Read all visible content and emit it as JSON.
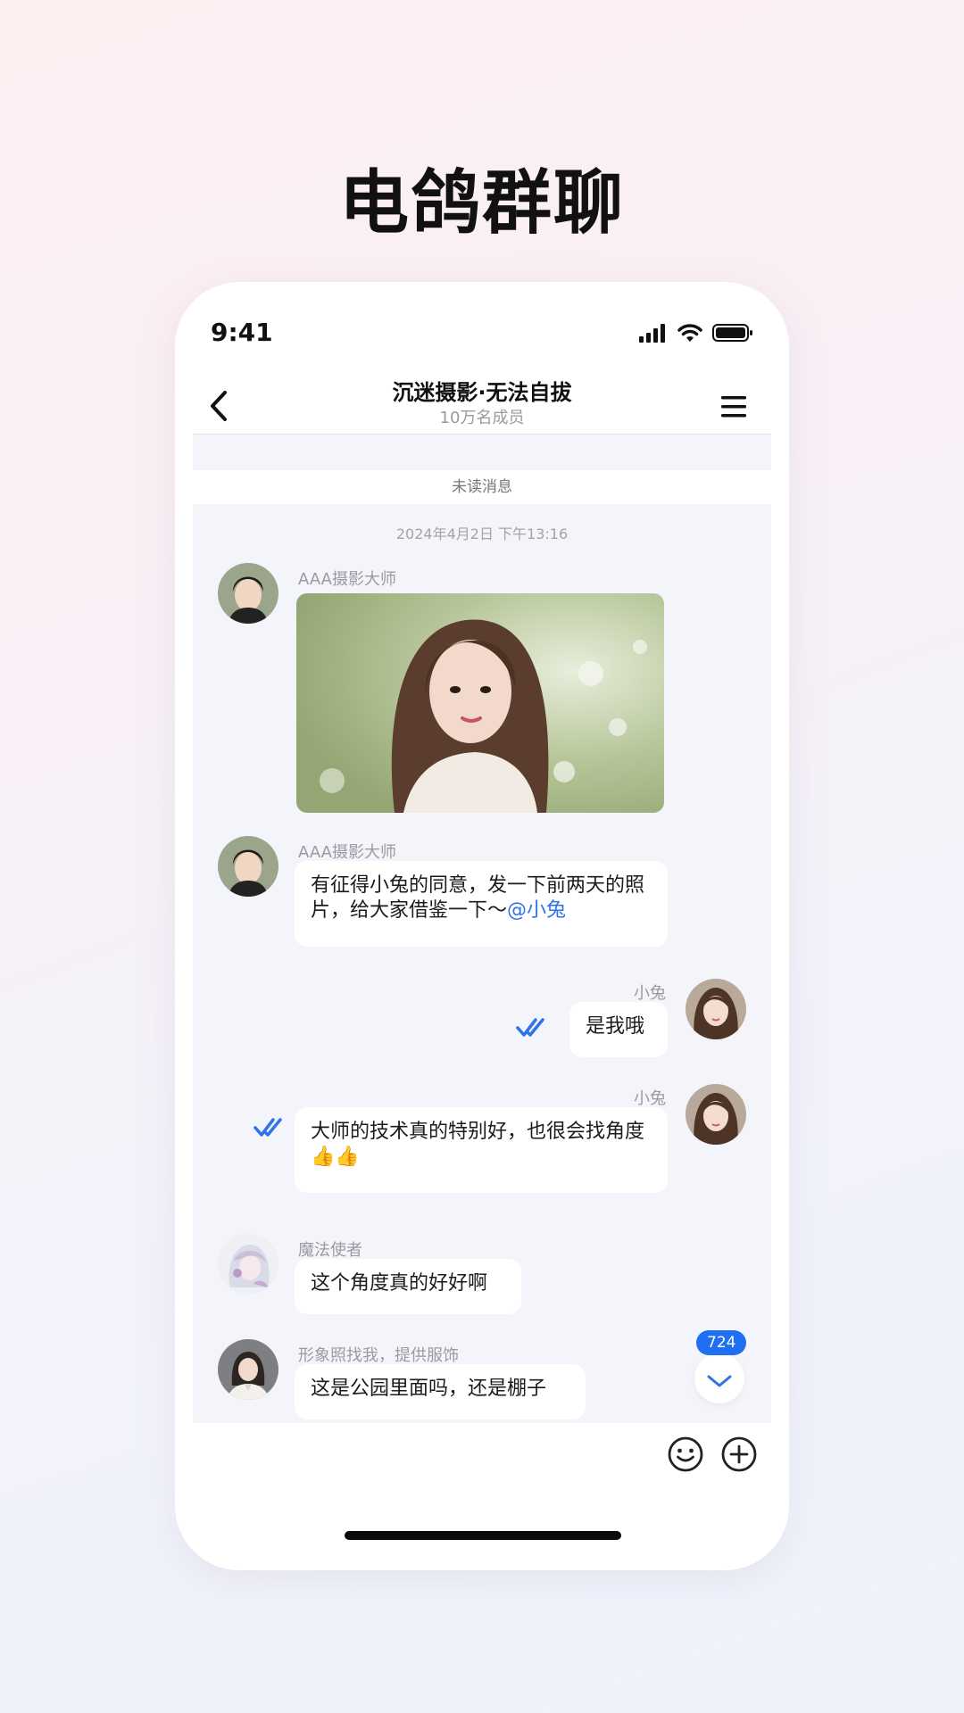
{
  "headline": "电鸽群聊",
  "status_bar": {
    "time": "9:41",
    "icons": [
      "signal-icon",
      "wifi-icon",
      "battery-icon"
    ]
  },
  "nav": {
    "title": "沉迷摄影·无法自拔",
    "subtitle": "10万名成员",
    "back_icon": "chevron-left-icon",
    "menu_icon": "hamburger-menu-icon"
  },
  "chat": {
    "unread_divider": "未读消息",
    "timestamp": "2024年4月2日 下午13:16",
    "messages": [
      {
        "sender": "AAA摄影大师",
        "type": "image"
      },
      {
        "sender": "AAA摄影大师",
        "type": "text",
        "text": "有征得小兔的同意，发一下前两天的照片，给大家借鉴一下～",
        "mention": "@小兔"
      },
      {
        "sender": "小兔",
        "type": "text",
        "text": "是我哦",
        "read_icon": "double-check-icon"
      },
      {
        "sender": "小兔",
        "type": "text",
        "text": "大师的技术真的特别好，也很会找角度👍👍",
        "read_icon": "double-check-icon"
      },
      {
        "sender": "魔法使者",
        "type": "text",
        "text": "这个角度真的好好啊"
      },
      {
        "sender": "形象照找我，提供服饰",
        "type": "text",
        "text": "这是公园里面吗，还是棚子"
      }
    ],
    "unread_count": "724",
    "scroll_icon": "chevron-down-icon"
  },
  "input_bar": {
    "emoji_icon": "smiley-icon",
    "plus_icon": "plus-circle-icon"
  },
  "colors": {
    "accent": "#1f6ff2",
    "mention": "#2f74e6",
    "chat_bg": "#f4f5fa"
  }
}
